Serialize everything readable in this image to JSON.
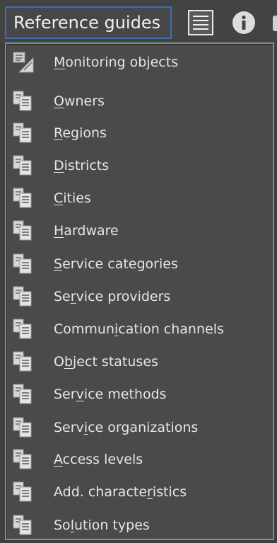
{
  "header": {
    "menu_label": "Reference guides",
    "icons": [
      "list-icon",
      "info-icon"
    ]
  },
  "dropdown": {
    "items": [
      {
        "label": "Monitoring objects",
        "mnemonic_index": 0,
        "icon": "monitoring-objects-icon"
      },
      {
        "label": "Owners",
        "mnemonic_index": 0,
        "icon": "documents-icon"
      },
      {
        "label": "Regions",
        "mnemonic_index": 0,
        "icon": "documents-icon"
      },
      {
        "label": "Districts",
        "mnemonic_index": 0,
        "icon": "documents-icon"
      },
      {
        "label": "Cities",
        "mnemonic_index": 0,
        "icon": "documents-icon"
      },
      {
        "label": "Hardware",
        "mnemonic_index": 0,
        "icon": "documents-icon"
      },
      {
        "label": "Service categories",
        "mnemonic_index": 0,
        "icon": "documents-icon"
      },
      {
        "label": "Service providers",
        "mnemonic_index": 2,
        "icon": "documents-icon"
      },
      {
        "label": "Communication channels",
        "mnemonic_index": 6,
        "icon": "documents-icon"
      },
      {
        "label": "Object statuses",
        "mnemonic_index": 1,
        "icon": "documents-icon"
      },
      {
        "label": "Service methods",
        "mnemonic_index": 3,
        "icon": "documents-icon"
      },
      {
        "label": "Service organizations",
        "mnemonic_index": 4,
        "icon": "documents-icon"
      },
      {
        "label": "Access levels",
        "mnemonic_index": 0,
        "icon": "documents-icon"
      },
      {
        "label": "Add. characteristics",
        "mnemonic_index": 13,
        "icon": "documents-icon"
      },
      {
        "label": "Solution types",
        "mnemonic_index": 2,
        "icon": "documents-icon"
      }
    ]
  },
  "colors": {
    "background": "#3f3f3f",
    "menu_background": "#4a4a4a",
    "active_border": "#3a6fb8",
    "text": "#e6e6e6"
  }
}
